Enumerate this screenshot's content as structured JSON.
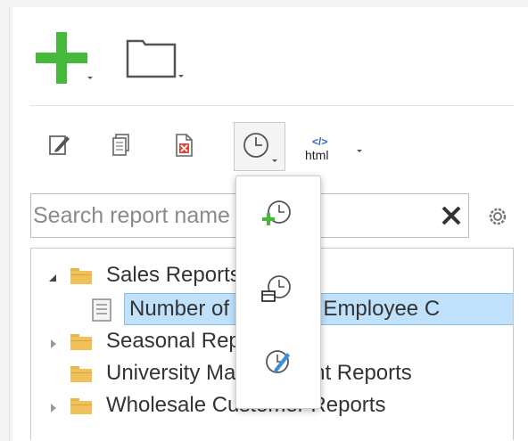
{
  "toolbar": {
    "new_icon": "plus-icon",
    "folder_icon": "folder-outline-icon",
    "tools": [
      {
        "name": "edit-icon"
      },
      {
        "name": "copy-icon"
      },
      {
        "name": "delete-icon"
      },
      {
        "name": "schedule-icon"
      },
      {
        "name": "html-export-icon"
      }
    ],
    "html_code": "</>",
    "html_label": "html"
  },
  "search": {
    "placeholder": "Search report name",
    "value": ""
  },
  "tree": [
    {
      "label": "Sales Reports",
      "expanded": true,
      "type": "folder"
    },
    {
      "label": "Number of Sales by Employee C",
      "type": "report",
      "selected": true
    },
    {
      "label": "Seasonal Reports",
      "type": "folder"
    },
    {
      "label": "University Management Reports",
      "type": "folder"
    },
    {
      "label": "Wholesale Customer Reports",
      "type": "folder"
    }
  ],
  "schedule_menu": [
    {
      "icon": "add-schedule-icon"
    },
    {
      "icon": "delete-schedule-icon"
    },
    {
      "icon": "edit-schedule-icon"
    }
  ],
  "colors": {
    "accent_green": "#46b83a",
    "selection": "#bfe1fb",
    "folder": "#f0c05a",
    "delete_red": "#e0463a",
    "link_blue": "#2a66c6"
  }
}
